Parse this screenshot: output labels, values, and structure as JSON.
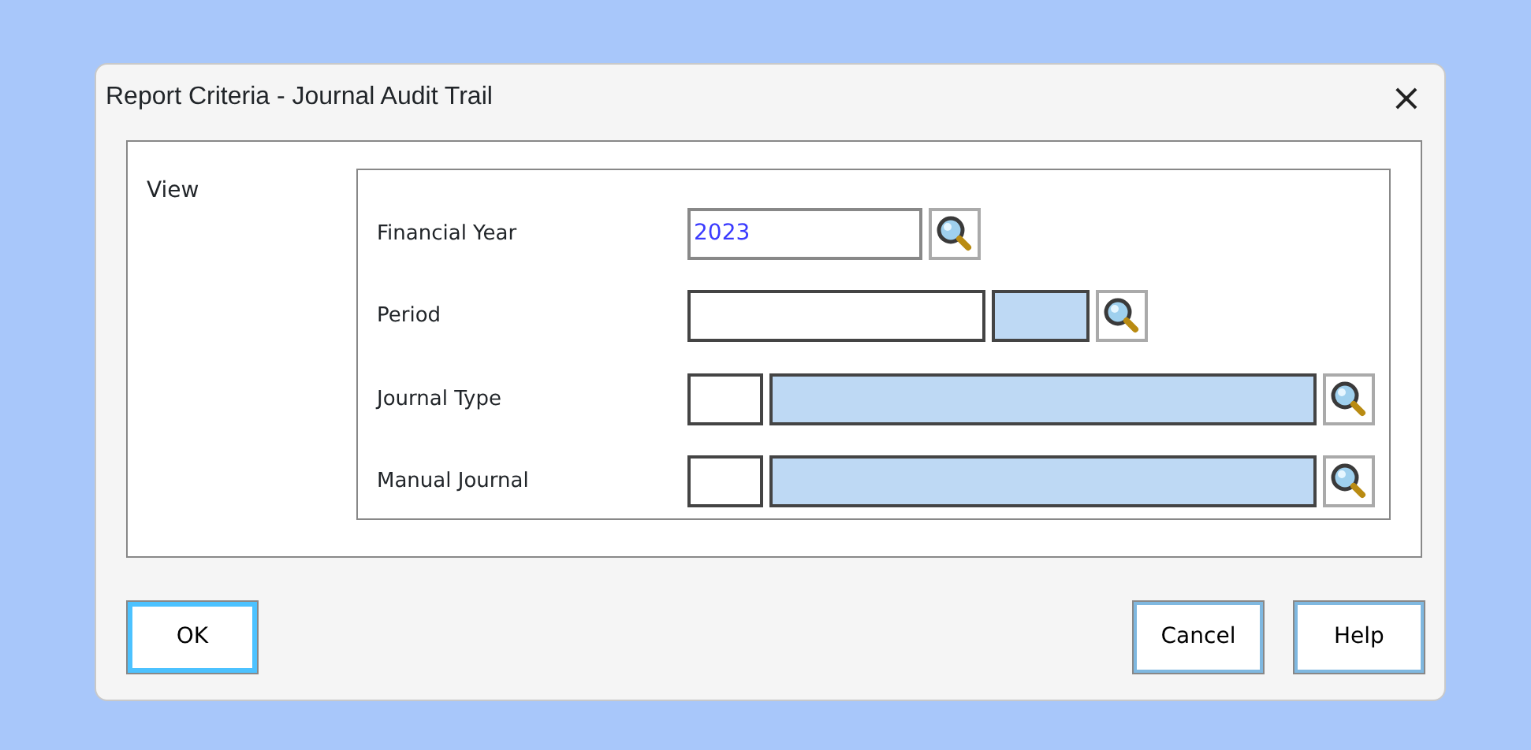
{
  "window": {
    "title": "Report Criteria - Journal Audit Trail",
    "close": "×"
  },
  "section": {
    "label": "View"
  },
  "rows": [
    {
      "label": "Financial Year",
      "parts": [
        {
          "kind": "text",
          "value": "2023"
        },
        {
          "kind": "search"
        }
      ]
    },
    {
      "label": "Period",
      "parts": [
        {
          "kind": "text"
        },
        {
          "kind": "lookup"
        },
        {
          "kind": "search"
        }
      ]
    },
    {
      "label": "Journal Type",
      "parts": [
        {
          "kind": "text"
        },
        {
          "kind": "lookup"
        },
        {
          "kind": "search"
        }
      ]
    },
    {
      "label": "Manual Journal",
      "parts": [
        {
          "kind": "text"
        },
        {
          "kind": "lookup"
        },
        {
          "kind": "search"
        }
      ]
    }
  ],
  "buttons": [
    {
      "label": "OK",
      "default": true
    },
    {
      "label": "Cancel",
      "default": false
    },
    {
      "label": "Help",
      "default": false
    }
  ]
}
